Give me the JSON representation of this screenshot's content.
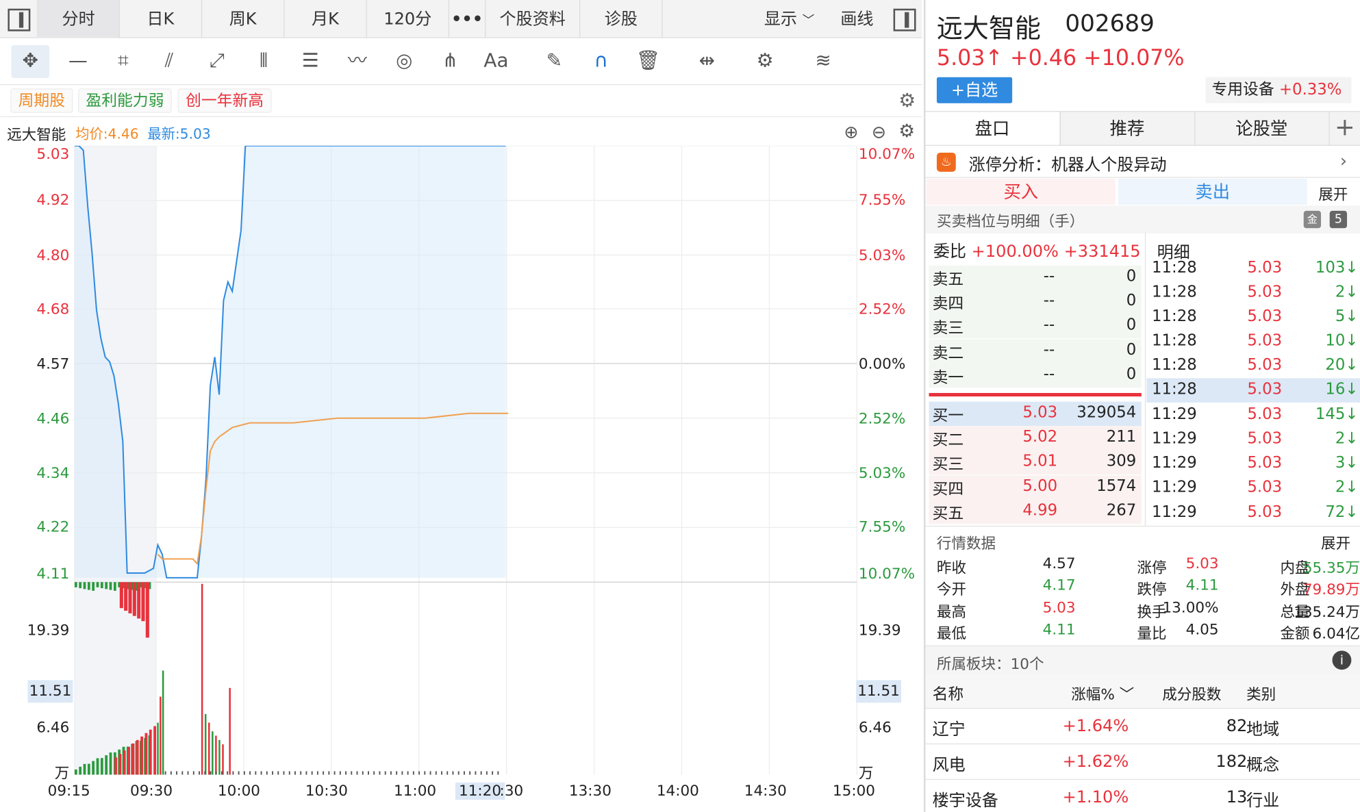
{
  "tabs": [
    {
      "label": ""
    },
    {
      "label": "分时"
    },
    {
      "label": "日K"
    },
    {
      "label": "周K"
    },
    {
      "label": "月K"
    },
    {
      "label": "120分"
    },
    {
      "label": "•••"
    },
    {
      "label": "个股资料"
    },
    {
      "label": "诊股"
    }
  ],
  "tabs_right": {
    "display": "显示",
    "draw": "画线"
  },
  "toolbar_icons": [
    "move-icon",
    "line-icon",
    "crop-icon",
    "fan-icon",
    "segment-icon",
    "channel-icon",
    "label-icon",
    "wave-icon",
    "cycle-icon",
    "fork-icon",
    "text-icon",
    "eraser-icon",
    "magnet-icon",
    "trash-icon",
    "fit-icon",
    "settings-icon",
    "layers-icon"
  ],
  "toolbar_text": {
    "text_tool": "Aa"
  },
  "tags": [
    "周期股",
    "盈利能力弱",
    "创一年新高"
  ],
  "chart_header": {
    "name": "远大智能",
    "avg": "均价:4.46",
    "latest": "最新:5.03"
  },
  "chart_data": {
    "type": "line",
    "price_axis": [
      "5.03",
      "4.92",
      "4.80",
      "4.68",
      "4.57",
      "4.46",
      "4.34",
      "4.22",
      "4.11"
    ],
    "pct_axis": [
      "10.07%",
      "7.55%",
      "5.03%",
      "2.52%",
      "0.00%",
      "2.52%",
      "5.03%",
      "7.55%",
      "10.07%"
    ],
    "vol_axis": [
      "19.39",
      "11.51",
      "6.46",
      "万"
    ],
    "vol_cursor": "11.51",
    "time_axis": [
      "09:15",
      "09:30",
      "10:00",
      "10:30",
      "11:00",
      "11:20",
      ":30",
      "13:30",
      "14:00",
      "14:30",
      "15:00"
    ],
    "ylim": [
      4.11,
      5.03
    ],
    "price": [
      [
        0,
        5.03
      ],
      [
        1,
        5.03
      ],
      [
        2,
        5.02
      ],
      [
        3,
        4.9
      ],
      [
        4,
        4.8
      ],
      [
        5,
        4.68
      ],
      [
        6,
        4.62
      ],
      [
        7,
        4.58
      ],
      [
        8,
        4.57
      ],
      [
        9,
        4.54
      ],
      [
        10,
        4.48
      ],
      [
        11,
        4.4
      ],
      [
        12,
        4.12
      ],
      [
        14,
        4.12
      ],
      [
        16,
        4.12
      ],
      [
        18,
        4.13
      ],
      [
        19,
        4.18
      ],
      [
        20,
        4.16
      ],
      [
        21,
        4.11
      ],
      [
        26,
        4.11
      ],
      [
        28,
        4.11
      ],
      [
        29,
        4.2
      ],
      [
        30,
        4.32
      ],
      [
        31,
        4.52
      ],
      [
        32,
        4.58
      ],
      [
        33,
        4.5
      ],
      [
        34,
        4.7
      ],
      [
        35,
        4.74
      ],
      [
        36,
        4.72
      ],
      [
        38,
        4.85
      ],
      [
        39,
        5.03
      ]
    ],
    "avg": [
      [
        19,
        4.16
      ],
      [
        20,
        4.15
      ],
      [
        22,
        4.15
      ],
      [
        27,
        4.15
      ],
      [
        28,
        4.14
      ],
      [
        29,
        4.2
      ],
      [
        30,
        4.3
      ],
      [
        31,
        4.38
      ],
      [
        32,
        4.4
      ],
      [
        33,
        4.41
      ],
      [
        36,
        4.43
      ],
      [
        40,
        4.44
      ],
      [
        50,
        4.44
      ],
      [
        60,
        4.45
      ],
      [
        70,
        4.45
      ],
      [
        80,
        4.45
      ],
      [
        90,
        4.46
      ],
      [
        99,
        4.46
      ]
    ]
  },
  "stock": {
    "name": "远大智能",
    "code": "002689",
    "price": "5.03↑",
    "change": "+0.46",
    "pct": "+10.07%",
    "add": "+自选",
    "sector": "专用设备",
    "sector_pct": "+0.33%"
  },
  "right_tabs": [
    "盘口",
    "推荐",
    "论股堂"
  ],
  "news": "涨停分析：机器人个股异动",
  "buy_label": "买入",
  "sell_label": "卖出",
  "expand": "展开",
  "ob_title": "买卖档位与明细（手）",
  "ob_badge": "5",
  "weibi": {
    "label": "委比",
    "pct": "+100.00%",
    "vol": "+331415"
  },
  "detail_label": "明细",
  "asks": [
    {
      "n": "卖五",
      "p": "--",
      "v": "0"
    },
    {
      "n": "卖四",
      "p": "--",
      "v": "0"
    },
    {
      "n": "卖三",
      "p": "--",
      "v": "0"
    },
    {
      "n": "卖二",
      "p": "--",
      "v": "0"
    },
    {
      "n": "卖一",
      "p": "--",
      "v": "0"
    }
  ],
  "bids": [
    {
      "n": "买一",
      "p": "5.03",
      "v": "329054"
    },
    {
      "n": "买二",
      "p": "5.02",
      "v": "211"
    },
    {
      "n": "买三",
      "p": "5.01",
      "v": "309"
    },
    {
      "n": "买四",
      "p": "5.00",
      "v": "1574"
    },
    {
      "n": "买五",
      "p": "4.99",
      "v": "267"
    }
  ],
  "details": [
    {
      "t": "11:28",
      "p": "5.03",
      "v": "103↓"
    },
    {
      "t": "11:28",
      "p": "5.03",
      "v": "2↓"
    },
    {
      "t": "11:28",
      "p": "5.03",
      "v": "5↓"
    },
    {
      "t": "11:28",
      "p": "5.03",
      "v": "10↓"
    },
    {
      "t": "11:28",
      "p": "5.03",
      "v": "20↓"
    },
    {
      "t": "11:28",
      "p": "5.03",
      "v": "16↓"
    },
    {
      "t": "11:29",
      "p": "5.03",
      "v": "145↓"
    },
    {
      "t": "11:29",
      "p": "5.03",
      "v": "2↓"
    },
    {
      "t": "11:29",
      "p": "5.03",
      "v": "3↓"
    },
    {
      "t": "11:29",
      "p": "5.03",
      "v": "2↓"
    },
    {
      "t": "11:29",
      "p": "5.03",
      "v": "72↓"
    }
  ],
  "market_title": "行情数据",
  "market_expand": "展开",
  "market": [
    [
      {
        "l": "昨收",
        "v": "4.57"
      },
      {
        "l": "涨停",
        "v": "5.03"
      },
      {
        "l": "内盘",
        "v": "55.35万"
      }
    ],
    [
      {
        "l": "今开",
        "v": "4.17"
      },
      {
        "l": "跌停",
        "v": "4.11"
      },
      {
        "l": "外盘",
        "v": "79.89万"
      }
    ],
    [
      {
        "l": "最高",
        "v": "5.03"
      },
      {
        "l": "换手",
        "v": "13.00%"
      },
      {
        "l": "总量",
        "v": "135.24万"
      }
    ],
    [
      {
        "l": "最低",
        "v": "4.11"
      },
      {
        "l": "量比",
        "v": "4.05"
      },
      {
        "l": "金额",
        "v": "6.04亿"
      }
    ]
  ],
  "sectors_title": "所属板块：10个",
  "sector_headers": [
    "名称",
    "涨幅%",
    "成分股数",
    "类别"
  ],
  "sectors": [
    {
      "n": "辽宁",
      "p": "+1.64%",
      "c": "82",
      "k": "地域"
    },
    {
      "n": "风电",
      "p": "+1.62%",
      "c": "182",
      "k": "概念"
    },
    {
      "n": "楼宇设备",
      "p": "+1.10%",
      "c": "13",
      "k": "行业"
    }
  ]
}
